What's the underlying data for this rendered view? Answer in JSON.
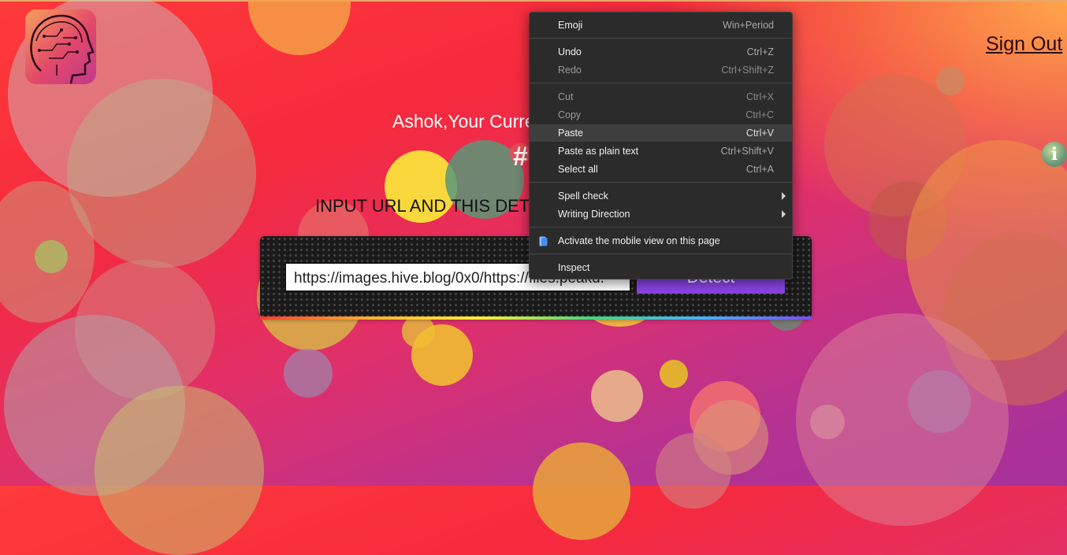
{
  "header": {
    "sign_out_label": "Sign Out",
    "info_icon_glyph": "i"
  },
  "main": {
    "greeting": "Ashok,Your Curre",
    "hash_symbol": "#",
    "instruction": "INPUT URL AND THIS DET",
    "url_value": "https://images.hive.blog/0x0/https://files.peakd.",
    "detect_label": "Detect"
  },
  "context_menu": {
    "items": [
      {
        "label": "Emoji",
        "shortcut": "Win+Period"
      },
      {
        "label": "Undo",
        "shortcut": "Ctrl+Z"
      },
      {
        "label": "Redo",
        "shortcut": "Ctrl+Shift+Z"
      },
      {
        "label": "Cut",
        "shortcut": "Ctrl+X"
      },
      {
        "label": "Copy",
        "shortcut": "Ctrl+C"
      },
      {
        "label": "Paste",
        "shortcut": "Ctrl+V"
      },
      {
        "label": "Paste as plain text",
        "shortcut": "Ctrl+Shift+V"
      },
      {
        "label": "Select all",
        "shortcut": "Ctrl+A"
      },
      {
        "label": "Spell check",
        "shortcut": ""
      },
      {
        "label": "Writing Direction",
        "shortcut": ""
      },
      {
        "label": "Activate the mobile view on this page",
        "shortcut": ""
      },
      {
        "label": "Inspect",
        "shortcut": ""
      }
    ]
  },
  "colors": {
    "background_start": "#ff3a3a",
    "background_end": "#a6309a",
    "accent": "#8a44e6",
    "menu_bg": "#2b2b2b"
  },
  "icons": [
    "brain-logo-icon",
    "info-icon",
    "mobile-view-icon",
    "chevron-right-icon"
  ]
}
